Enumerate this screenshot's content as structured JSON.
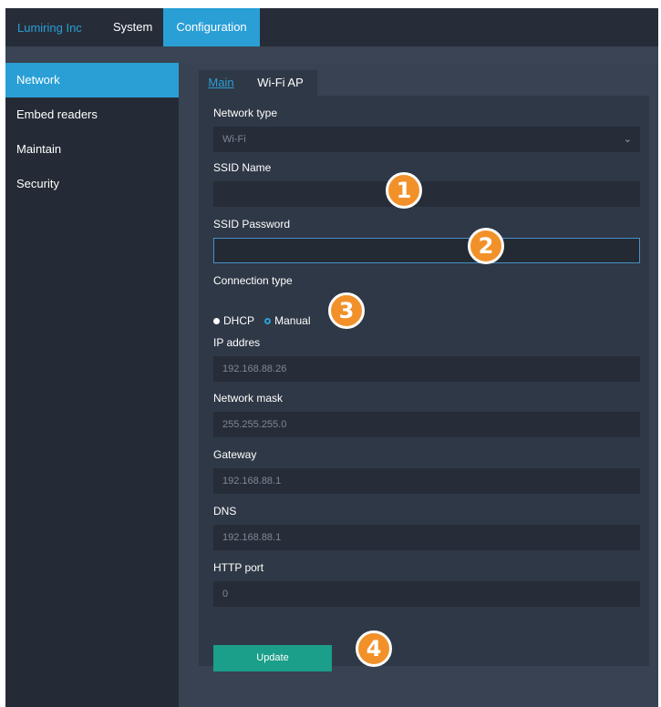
{
  "header": {
    "brand": "Lumiring Inc",
    "nav": [
      {
        "label": "System"
      },
      {
        "label": "Configuration"
      }
    ]
  },
  "sidebar": {
    "items": [
      {
        "label": "Network"
      },
      {
        "label": "Embed readers"
      },
      {
        "label": "Maintain"
      },
      {
        "label": "Security"
      }
    ]
  },
  "tabs": [
    {
      "label": "Main"
    },
    {
      "label": "Wi-Fi AP"
    }
  ],
  "form": {
    "network_type": {
      "label": "Network type",
      "value": "Wi-Fi"
    },
    "ssid_name": {
      "label": "SSID Name",
      "value": ""
    },
    "ssid_password": {
      "label": "SSID Password",
      "value": ""
    },
    "connection_type": {
      "label": "Connection type",
      "options": [
        "DHCP",
        "Manual"
      ],
      "selected": "Manual"
    },
    "ip_address": {
      "label": "IP addres",
      "value": "192.168.88.26"
    },
    "network_mask": {
      "label": "Network mask",
      "value": "255.255.255.0"
    },
    "gateway": {
      "label": "Gateway",
      "value": "192.168.88.1"
    },
    "dns": {
      "label": "DNS",
      "value": "192.168.88.1"
    },
    "http_port": {
      "label": "HTTP port",
      "value": "0"
    },
    "update_label": "Update"
  },
  "callouts": [
    "1",
    "2",
    "3",
    "4"
  ],
  "colors": {
    "accent": "#2a9fd6",
    "button": "#1b9e8a",
    "callout": "#f2912a",
    "background": "#252c37"
  }
}
